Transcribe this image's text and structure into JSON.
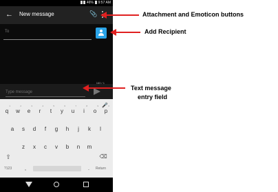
{
  "status_bar": {
    "time": "9:57 AM",
    "battery": "46%"
  },
  "app_bar": {
    "back_icon": "arrow-left-icon",
    "title": "New message",
    "attach_icon": "paperclip-icon",
    "more_icon": "more-vert-icon"
  },
  "recipient": {
    "label": "To",
    "add_icon": "add-contact-icon"
  },
  "compose": {
    "placeholder": "Type message",
    "counter": "160 / 1",
    "send_icon": "send-icon"
  },
  "keyboard": {
    "mic_icon": "mic-icon",
    "row1": [
      {
        "key": "q",
        "hint": "1"
      },
      {
        "key": "w",
        "hint": "2"
      },
      {
        "key": "e",
        "hint": "3"
      },
      {
        "key": "r",
        "hint": "4"
      },
      {
        "key": "t",
        "hint": "5"
      },
      {
        "key": "y",
        "hint": "6"
      },
      {
        "key": "u",
        "hint": "7"
      },
      {
        "key": "i",
        "hint": "8"
      },
      {
        "key": "o",
        "hint": "9"
      },
      {
        "key": "p",
        "hint": "0"
      }
    ],
    "row2": [
      "a",
      "s",
      "d",
      "f",
      "g",
      "h",
      "j",
      "k",
      "l"
    ],
    "row3": [
      "z",
      "x",
      "c",
      "v",
      "b",
      "n",
      "m"
    ],
    "shift_icon": "shift-icon",
    "backspace_icon": "backspace-icon",
    "symbols_key": "?123",
    "comma_key": ",",
    "period_key": ".",
    "return_key": "Return"
  },
  "nav_bar": {
    "back_icon": "nav-back-icon",
    "home_icon": "nav-home-icon",
    "recents_icon": "nav-recents-icon"
  },
  "annotations": {
    "attachment": "Attachment and Emoticon buttons",
    "recipient": "Add Recipient",
    "entry_line1": "Text message",
    "entry_line2": "entry field",
    "arrow_color": "#e02020"
  }
}
